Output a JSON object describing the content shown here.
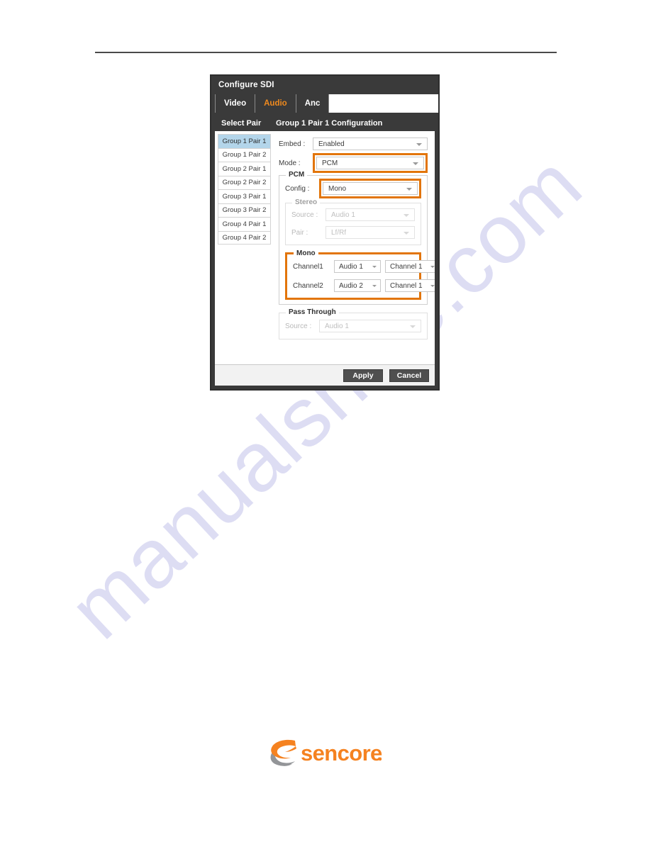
{
  "page": {
    "watermark": "manualshive.com"
  },
  "dialog": {
    "title": "Configure SDI",
    "tabs": [
      {
        "label": "Video",
        "active": false
      },
      {
        "label": "Audio",
        "active": true
      },
      {
        "label": "Anc",
        "active": false
      }
    ],
    "panel_headers": {
      "left": "Select Pair",
      "right": "Group 1 Pair 1 Configuration"
    },
    "pair_list": [
      {
        "label": "Group 1 Pair 1",
        "selected": true
      },
      {
        "label": "Group 1 Pair 2",
        "selected": false
      },
      {
        "label": "Group 2 Pair 1",
        "selected": false
      },
      {
        "label": "Group 2 Pair 2",
        "selected": false
      },
      {
        "label": "Group 3 Pair 1",
        "selected": false
      },
      {
        "label": "Group 3 Pair 2",
        "selected": false
      },
      {
        "label": "Group 4 Pair 1",
        "selected": false
      },
      {
        "label": "Group 4 Pair 2",
        "selected": false
      }
    ],
    "form": {
      "embed": {
        "label": "Embed :",
        "value": "Enabled"
      },
      "mode": {
        "label": "Mode :",
        "value": "PCM",
        "highlighted": true
      },
      "pcm": {
        "legend": "PCM",
        "config": {
          "label": "Config :",
          "value": "Mono",
          "highlighted": true
        },
        "stereo": {
          "legend": "Stereo",
          "disabled": true,
          "source": {
            "label": "Source :",
            "value": "Audio 1"
          },
          "pair": {
            "label": "Pair :",
            "value": "Lf/Rf"
          }
        },
        "mono": {
          "legend": "Mono",
          "highlighted": true,
          "channel1": {
            "label": "Channel1",
            "source": "Audio 1",
            "channel": "Channel 1"
          },
          "channel2": {
            "label": "Channel2",
            "source": "Audio 2",
            "channel": "Channel 1"
          }
        }
      },
      "pass_through": {
        "legend": "Pass Through",
        "disabled": true,
        "source": {
          "label": "Source :",
          "value": "Audio 1"
        }
      }
    },
    "footer": {
      "apply_label": "Apply",
      "cancel_label": "Cancel"
    }
  },
  "logo": {
    "text": "sencore",
    "trademark": "."
  },
  "colors": {
    "accent_orange": "#e2750a",
    "tab_active_orange": "#f08a1e",
    "dialog_chrome": "#3a3a3a",
    "selection_blue": "#b3d5ea",
    "watermark": "#c9c9ec",
    "logo_orange": "#f58220",
    "logo_grey": "#939598"
  }
}
